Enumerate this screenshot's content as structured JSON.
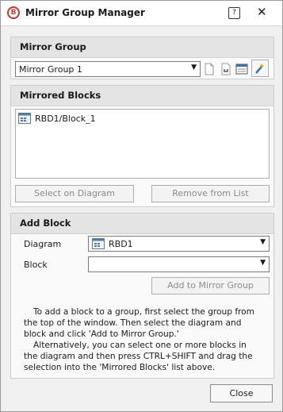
{
  "window": {
    "title": "Mirror Group Manager",
    "help_label": "?",
    "close_glyph": "✕"
  },
  "mirror_group": {
    "header": "Mirror Group",
    "selected": "Mirror Group 1",
    "tools": [
      "new-group-icon",
      "rename-group-icon",
      "properties-icon",
      "settings-wand-icon"
    ]
  },
  "mirrored_blocks": {
    "header": "Mirrored Blocks",
    "items": [
      {
        "label": "RBD1/Block_1",
        "icon": "diagram-block-icon"
      }
    ],
    "select_label": "Select on Diagram",
    "remove_label": "Remove from List"
  },
  "add_block": {
    "header": "Add Block",
    "diagram_label": "Diagram",
    "diagram_value": "RBD1",
    "block_label": "Block",
    "block_value": "",
    "add_label": "Add to Mirror Group",
    "hint1": "To add a block to a group, first select the group from the top of the window. Then select the diagram and block and click 'Add to Mirror Group.'",
    "hint2": "Alternatively, you can select one or more blocks in the diagram and then press CTRL+SHIFT and drag the selection into the 'Mirrored Blocks' list above."
  },
  "footer": {
    "close_label": "Close"
  }
}
